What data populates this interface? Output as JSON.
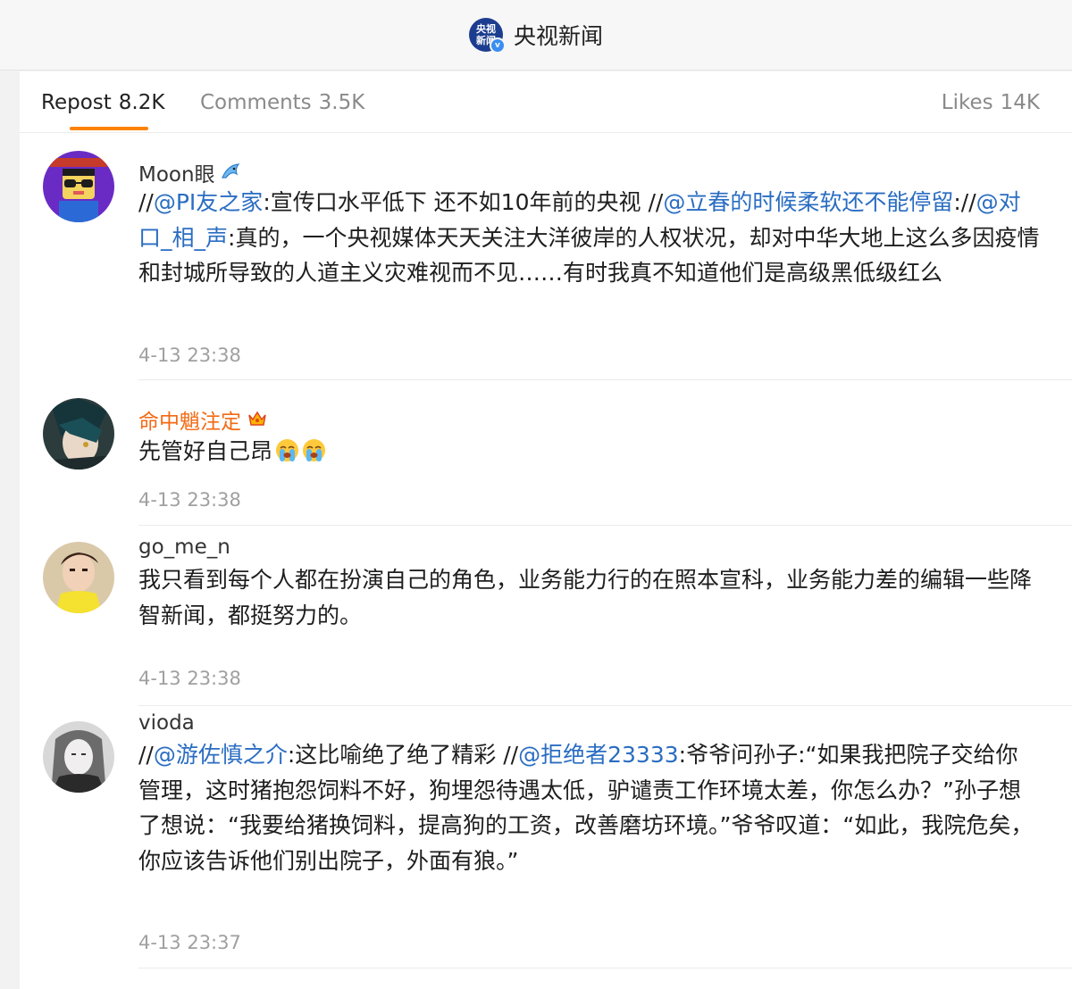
{
  "header": {
    "logo_text": "央视\n新闻",
    "verified_mark": "v",
    "title": "央视新闻"
  },
  "tabs": [
    {
      "label": "Repost",
      "count": "8.2K",
      "active": true
    },
    {
      "label": "Comments",
      "count": "3.5K",
      "active": false
    },
    {
      "label": "Likes",
      "count": "14K",
      "active": false
    }
  ],
  "reposts": [
    {
      "user": "Moon眼",
      "badge": "dolphin",
      "time": "4-13 23:38",
      "segments": [
        {
          "t": "//",
          "m": false
        },
        {
          "t": "@PI友之家",
          "m": true
        },
        {
          "t": ":宣传口水平低下 还不如10年前的央视 ",
          "m": false
        },
        {
          "t": "//",
          "m": false
        },
        {
          "t": "@立春的时候柔软还不能停留",
          "m": true
        },
        {
          "t": ":",
          "m": false
        },
        {
          "t": "//",
          "m": false
        },
        {
          "t": "@对口_相_声",
          "m": true
        },
        {
          "t": ":真的，一个央视媒体天天关注大洋彼岸的人权状况，却对中华大地上这么多因疫情和封城所导致的人道主义灾难视而不见……有时我真不知道他们是高级黑低级红么",
          "m": false
        }
      ]
    },
    {
      "user": "命中魈注定",
      "badge": "crown",
      "time": "4-13 23:38",
      "segments": [
        {
          "t": "先管好自己昂",
          "m": false
        }
      ],
      "emojis": [
        "crying-face-emoji",
        "crying-face-emoji"
      ]
    },
    {
      "user": "go_me_n",
      "badge": "",
      "time": "4-13 23:38",
      "segments": [
        {
          "t": "我只看到每个人都在扮演自己的角色，业务能力行的在照本宣科，业务能力差的编辑一些降智新闻，都挺努力的。",
          "m": false
        }
      ]
    },
    {
      "user": "vioda",
      "badge": "",
      "time": "4-13 23:37",
      "segments": [
        {
          "t": "//",
          "m": false
        },
        {
          "t": "@游佐慎之介",
          "m": true
        },
        {
          "t": ":这比喻绝了绝了精彩 ",
          "m": false
        },
        {
          "t": "//",
          "m": false
        },
        {
          "t": "@拒绝者23333",
          "m": true
        },
        {
          "t": ":爷爷问孙子:“如果我把院子交给你管理，这时猪抱怨饲料不好，狗埋怨待遇太低，驴谴责工作环境太差，你怎么办？”孙子想了想说：“我要给猪换饲料，提高狗的工资，改善磨坊环境。”爷爷叹道：“如此，我院危矣，你应该告诉他们别出院子，外面有狼。”",
          "m": false
        }
      ]
    }
  ],
  "colors": {
    "accent": "#ff8200",
    "mention": "#2a6dc2",
    "vip_name": "#f26a14",
    "brand_logo": "#1c3d8f"
  }
}
